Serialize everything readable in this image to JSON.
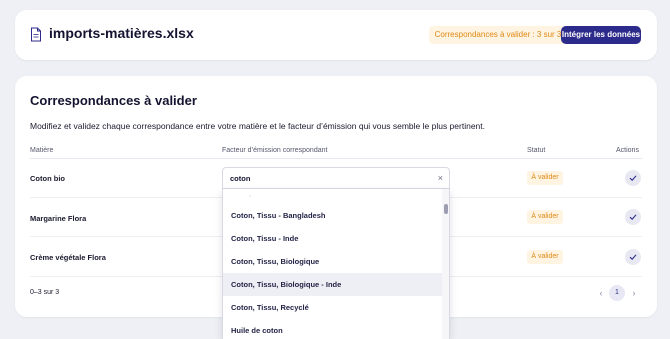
{
  "header": {
    "file_name": "imports-matières.xlsx",
    "pending_label": "Correspondances à valider : 3 sur 3",
    "integrate_button": "Intégrer les données"
  },
  "section": {
    "title": "Correspondances à valider",
    "description": "Modifiez et validez chaque correspondance entre votre matière et le facteur d’émission qui vous semble le plus pertinent."
  },
  "table": {
    "columns": [
      "Matière",
      "Facteur d’émission correspondant",
      "Statut",
      "Actions"
    ],
    "rows": [
      {
        "matiere": "Coton bio",
        "statut": "À valider"
      },
      {
        "matiere": "Margarine Flora",
        "statut": "À valider"
      },
      {
        "matiere": "Crème végétale Flora",
        "statut": "À valider"
      }
    ]
  },
  "combo": {
    "value": "coton",
    "clear_symbol": "×",
    "options": [
      "Coton, Tissu - Bangladesh",
      "Coton, Tissu - Inde",
      "Coton, Tissu, Biologique",
      "Coton, Tissu, Biologique - Inde",
      "Coton, Tissu, Recyclé",
      "Huile de coton"
    ],
    "highlighted_index": 3
  },
  "pagination": {
    "info": "0–3 sur 3",
    "prev": "‹",
    "current_page": "1",
    "next": "›"
  },
  "colors": {
    "primary": "#2c2a8a",
    "warning_text": "#e08a14",
    "warning_bg": "#fff3e2",
    "background": "#eef0f5"
  }
}
